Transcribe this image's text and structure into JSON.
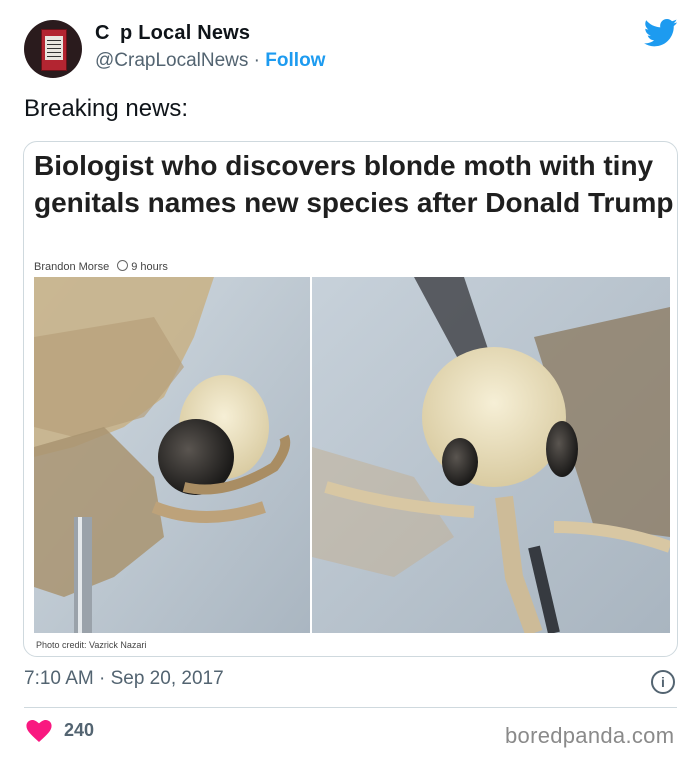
{
  "tweet": {
    "display_name": "C  p Local News",
    "handle": "@CrapLocalNews",
    "separator": " · ",
    "follow_label": "Follow",
    "text": "Breaking news:",
    "timestamp": "7:10 AM · Sep 20, 2017",
    "likes": "240",
    "info_icon_glyph": "i",
    "icons": [
      "avatar",
      "twitter-bird-icon",
      "info-icon",
      "heart-icon"
    ],
    "brand_color": "#1d9bf0",
    "heart_color": "#f91880"
  },
  "article": {
    "headline": "Biologist who discovers blonde moth with tiny genitals names new species after Donald Trump",
    "author": "Brandon Morse",
    "age": "9 hours",
    "photo_credit": "Photo credit: Vazrick Nazari"
  },
  "watermark": "boredpanda.com"
}
